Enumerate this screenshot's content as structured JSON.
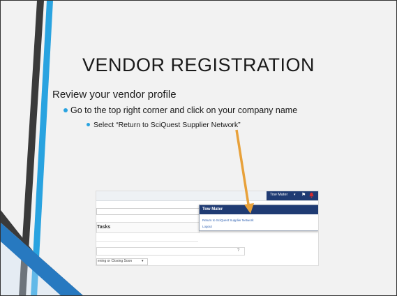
{
  "slide": {
    "title": "VENDOR REGISTRATION",
    "bullets": [
      "Review your vendor profile",
      "Go to the top right corner and click on your company name",
      "Select “Return to SciQuest Supplier Network”"
    ]
  },
  "screenshot": {
    "user_name": "Tow Mater",
    "user_caret": "▾",
    "flag_icon": "⚑",
    "menu": {
      "header": "Tow Mater",
      "items": [
        "Return to SciQuest Supplier Network",
        "Logout"
      ]
    },
    "tasks_heading": "Tasks",
    "help_marker": "?",
    "filter_select_value": "ening or Closing Soon",
    "select_caret": "▾"
  },
  "colors": {
    "accent_blue": "#29a3e0",
    "dark_stripe": "#3a3a3a",
    "header_navy": "#1f3b73",
    "arrow_orange": "#e8a13a",
    "bell_red": "#d62b2b"
  }
}
